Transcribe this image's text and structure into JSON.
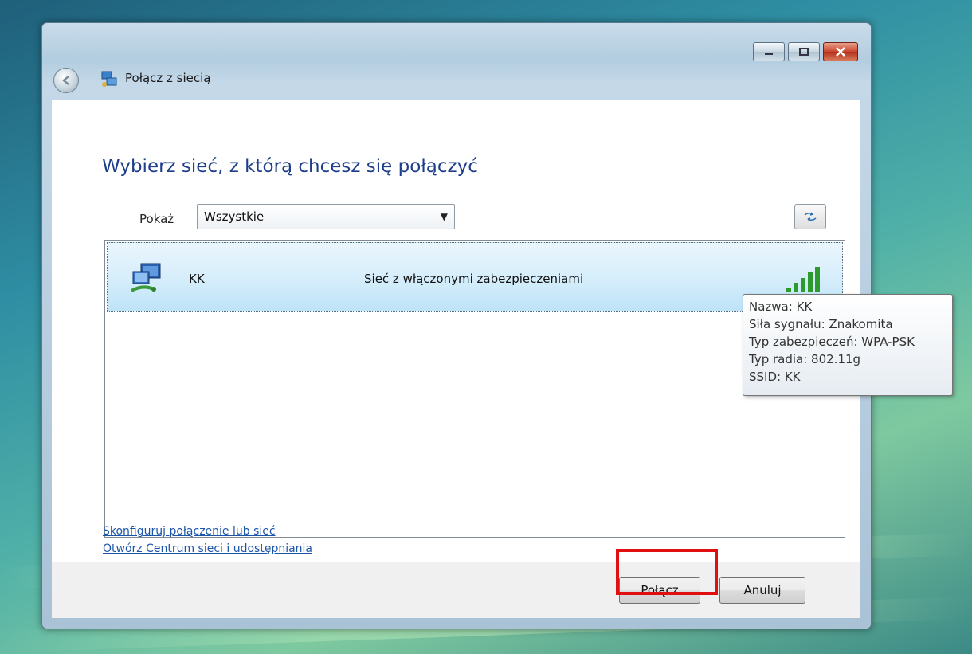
{
  "window": {
    "title": "Połącz z siecią"
  },
  "main": {
    "heading": "Wybierz sieć, z którą chcesz się połączyć",
    "show_label": "Pokaż",
    "filter_selected": "Wszystkie"
  },
  "networks": [
    {
      "name": "KK",
      "security": "Sieć z włączonymi zabezpieczeniami",
      "signal": "Znakomita"
    }
  ],
  "tooltip": {
    "lines": [
      "Nazwa: KK",
      "Siła sygnału: Znakomita",
      "Typ zabezpieczeń: WPA-PSK",
      "Typ radia: 802.11g",
      "SSID: KK"
    ]
  },
  "links": [
    "Skonfiguruj połączenie lub sieć",
    "Otwórz Centrum sieci i udostępniania"
  ],
  "buttons": {
    "connect": "Połącz",
    "cancel": "Anuluj"
  },
  "colors": {
    "heading": "#1e3d8a",
    "link": "#1a55aa",
    "highlight": "#e01010"
  }
}
